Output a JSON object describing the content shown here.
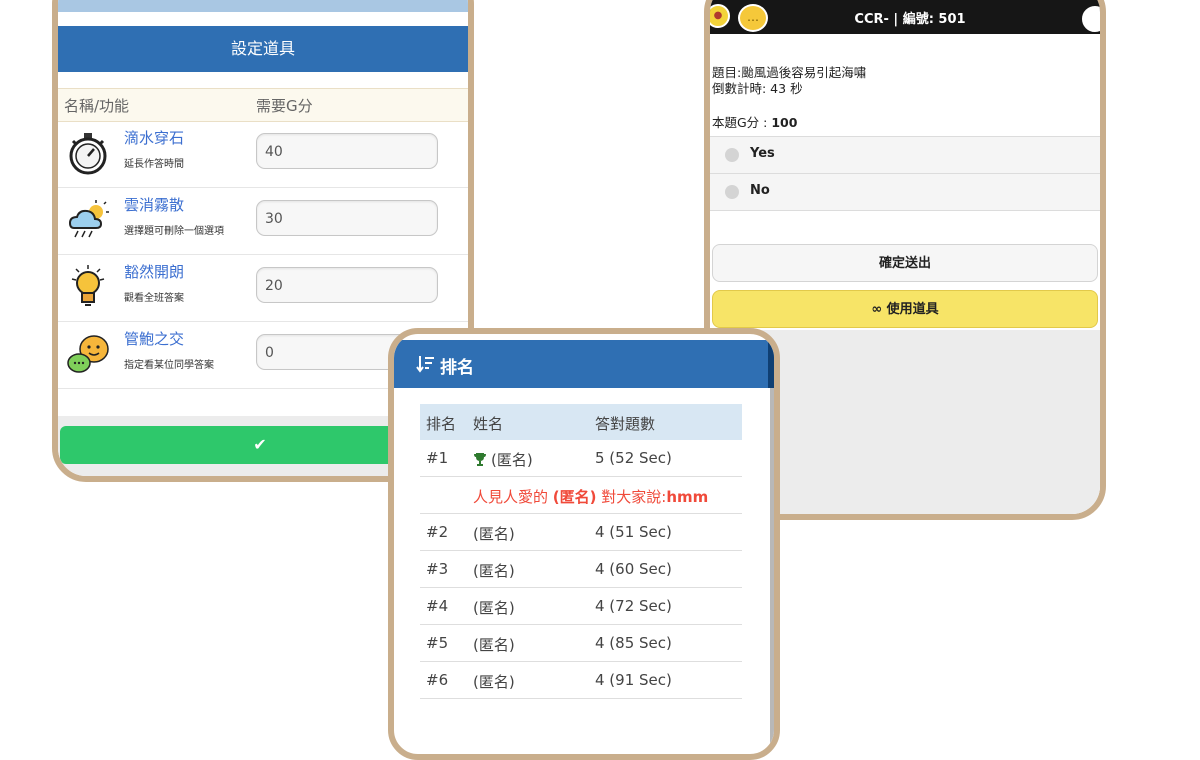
{
  "tools_panel": {
    "title": "設定道具",
    "col_name": "名稱/功能",
    "col_cost": "需要G分",
    "tools": [
      {
        "name": "滴水穿石",
        "desc": "延長作答時間",
        "cost": "40",
        "icon": "stopwatch-icon"
      },
      {
        "name": "雲消霧散",
        "desc": "選擇題可刪除一個選項",
        "cost": "30",
        "icon": "weather-icon"
      },
      {
        "name": "豁然開朗",
        "desc": "觀看全班答案",
        "cost": "20",
        "icon": "lightbulb-icon"
      },
      {
        "name": "管鮑之交",
        "desc": "指定看某位同學答案",
        "cost": "0",
        "icon": "chat-bubbles-icon"
      }
    ],
    "confirm_label": "✔"
  },
  "question_panel": {
    "header_title": "CCR- | 編號: 501",
    "question": "題目:颱風過後容易引起海嘯",
    "countdown": "倒數計時: 43 秒",
    "points_label": "本題G分 :",
    "points_value": "100",
    "options": [
      "Yes",
      "No"
    ],
    "submit_label": "確定送出",
    "use_tools_label": "使用道具",
    "colors": {
      "header": "#161616",
      "tools_button": "#f7e467"
    }
  },
  "ranking_panel": {
    "title": "排名",
    "headers": [
      "排名",
      "姓名",
      "答對題數"
    ],
    "rows": [
      {
        "rank": "#1",
        "name": "(匿名)",
        "score": "5 (52 Sec)",
        "trophy": true
      },
      {
        "rank": "#2",
        "name": "(匿名)",
        "score": "4 (51 Sec)"
      },
      {
        "rank": "#3",
        "name": "(匿名)",
        "score": "4 (60 Sec)"
      },
      {
        "rank": "#4",
        "name": "(匿名)",
        "score": "4 (72 Sec)"
      },
      {
        "rank": "#5",
        "name": "(匿名)",
        "score": "4 (85 Sec)"
      },
      {
        "rank": "#6",
        "name": "(匿名)",
        "score": "4 (91 Sec)"
      }
    ],
    "message": {
      "prefix": "人見人愛的",
      "name": "(匿名)",
      "middle": "對大家說:",
      "text": "hmm"
    },
    "colors": {
      "header": "#2f6fb3",
      "message": "#f04a3a"
    }
  },
  "frame_color": "#c9ae8c"
}
